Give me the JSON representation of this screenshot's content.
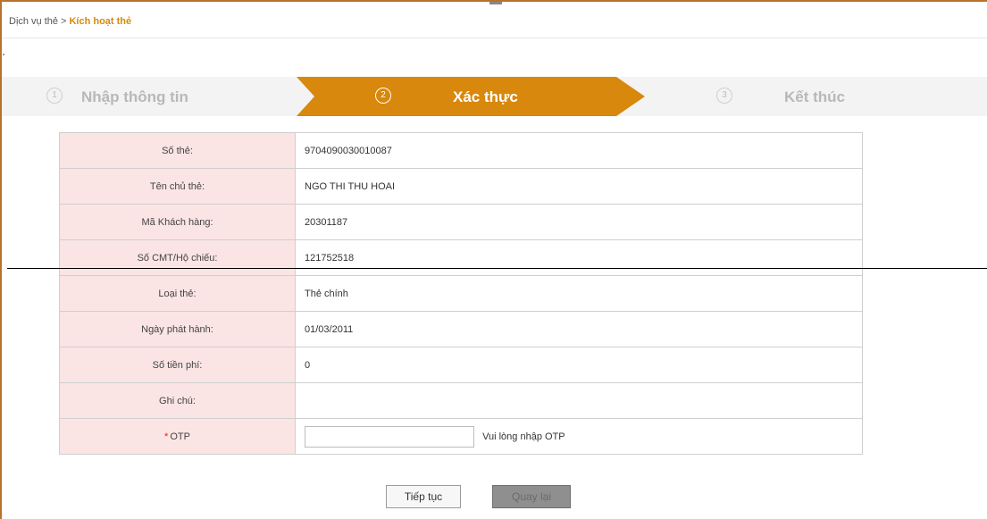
{
  "breadcrumb": {
    "parent": "Dịch vụ thẻ",
    "separator": ">",
    "current": "Kích hoạt thẻ"
  },
  "steps": [
    {
      "number": "1",
      "label": "Nhập thông tin",
      "state": "inactive"
    },
    {
      "number": "2",
      "label": "Xác thực",
      "state": "active"
    },
    {
      "number": "3",
      "label": "Kết thúc",
      "state": "inactive"
    }
  ],
  "form": {
    "rows": [
      {
        "label": "Số thẻ:",
        "value": "9704090030010087"
      },
      {
        "label": "Tên chủ thẻ:",
        "value": "NGO THI THU HOAI"
      },
      {
        "label": "Mã Khách hàng:",
        "value": "20301187"
      },
      {
        "label": "Số CMT/Hộ chiếu:",
        "value": "121752518"
      },
      {
        "label": "Loại thẻ:",
        "value": "Thẻ chính"
      },
      {
        "label": "Ngày phát hành:",
        "value": "01/03/2011"
      },
      {
        "label": "Số tiền phí:",
        "value": "0"
      },
      {
        "label": "Ghi chú:",
        "value": ""
      }
    ],
    "otp": {
      "required_mark": "*",
      "label": "OTP",
      "value": "",
      "hint": "Vui lòng nhập OTP"
    }
  },
  "buttons": {
    "next": "Tiếp tục",
    "back": "Quay lại"
  },
  "colors": {
    "accent": "#d8880c",
    "frame": "#b9722a",
    "label_bg": "#fbe4e4",
    "breadcrumb_current": "#d58a0c"
  },
  "icons": {
    "step_marker": "circled-number-icon"
  }
}
